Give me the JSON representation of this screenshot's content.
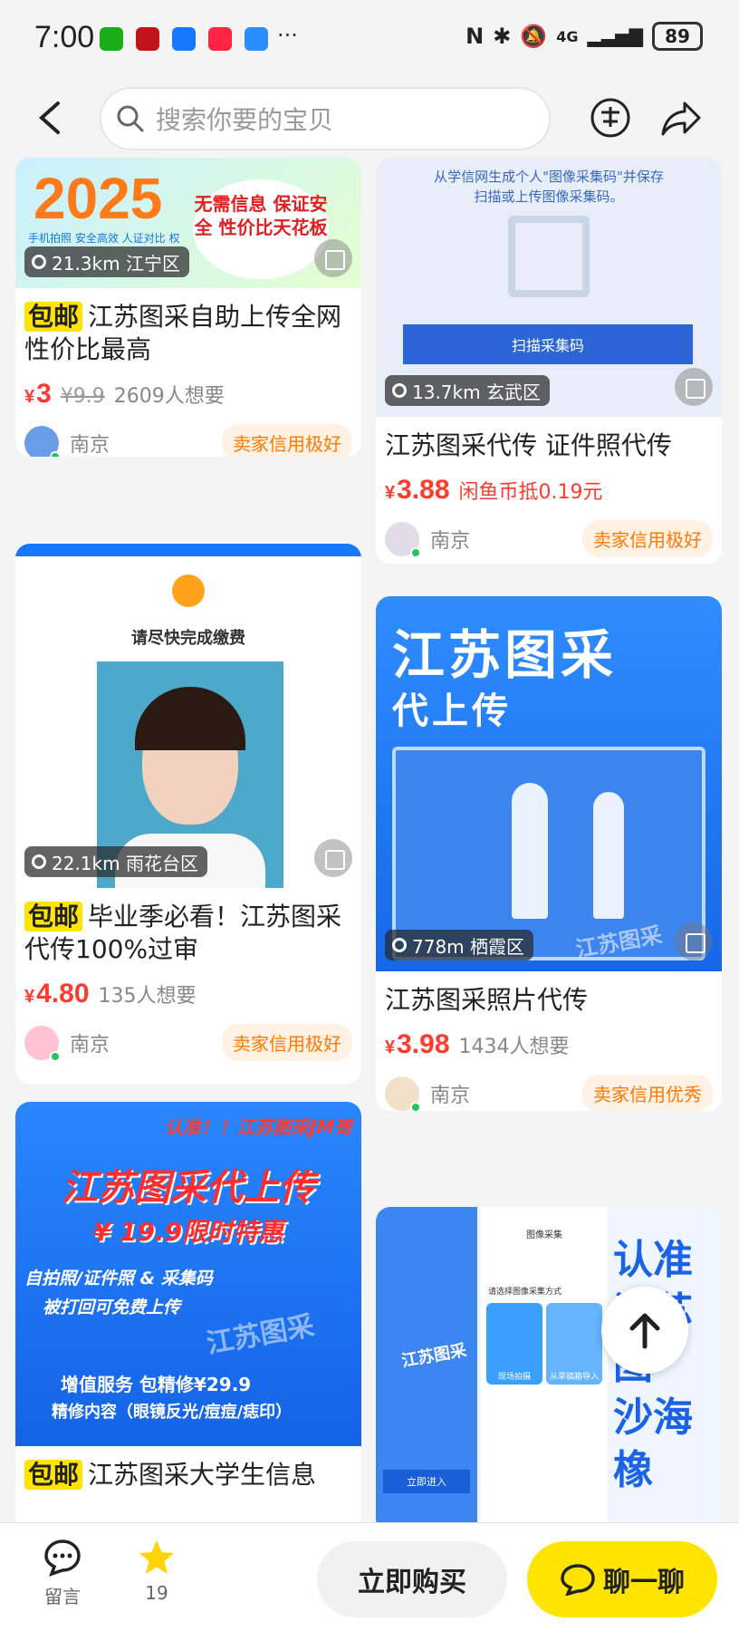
{
  "status_bar": {
    "time": "7:00",
    "network": "4G",
    "battery": "89"
  },
  "search": {
    "placeholder": "搜索你要的宝贝"
  },
  "feed": {
    "left": [
      {
        "image_text": "2025",
        "image_sub": "手机拍照  安全高效  人证对比  权",
        "image_badge": "无需信息 保证安全 性价比天花板",
        "location": "21.3km 江宁区",
        "tag": "包邮",
        "title": "江苏图采自助上传全网性价比最高",
        "price": "3",
        "old_price": "¥9.9",
        "want": "2609人想要",
        "city": "南京",
        "credit": "卖家信用极好"
      },
      {
        "image_text": "请尽快完成缴费",
        "location": "22.1km 雨花台区",
        "tag": "包邮",
        "title": "毕业季必看！江苏图采代传100%过审",
        "price": "4.80",
        "want": "135人想要",
        "city": "南京",
        "credit": "卖家信用极好"
      },
      {
        "image_lines": [
          "认准！！江苏图采JM哥",
          "江苏图采代上传",
          "¥ 19.9限时特惠",
          "自拍照/证件照 & 采集码",
          "被打回可免费上传",
          "江苏图采",
          "增值服务 包精修¥29.9",
          "精修内容（眼镜反光/痘痘/痣印）"
        ],
        "tag": "包邮",
        "title": "江苏图采大学生信息"
      }
    ],
    "right": [
      {
        "image_lines": [
          "从学信网生成个人\"图像采集码\"并保存",
          "扫描或上传图像采集码。",
          "扫描采集码"
        ],
        "location": "13.7km 玄武区",
        "title": "江苏图采代传 证件照代传",
        "price": "3.88",
        "coin": "闲鱼币抵0.19元",
        "city": "南京",
        "credit": "卖家信用极好"
      },
      {
        "image_lines": [
          "江苏图采",
          "代上传",
          "江苏图采"
        ],
        "location": "778m 栖霞区",
        "title": "江苏图采照片代传",
        "price": "3.98",
        "want": "1434人想要",
        "city": "南京",
        "credit": "卖家信用优秀"
      },
      {
        "image_lines": [
          "图像采集",
          "请选择图像采集方式",
          "现场拍摄",
          "从草稿箱导入",
          "江苏图采",
          "立即进入",
          "认准",
          "江苏图",
          "沙海",
          "橡"
        ]
      }
    ]
  },
  "bottom_bar": {
    "comment_label": "留言",
    "fav_count": "19",
    "buy_label": "立即购买",
    "chat_label": "聊一聊"
  },
  "colors": {
    "accent_yellow": "#ffe400",
    "price_red": "#ff3b30",
    "credit_orange": "#ff7a00"
  }
}
